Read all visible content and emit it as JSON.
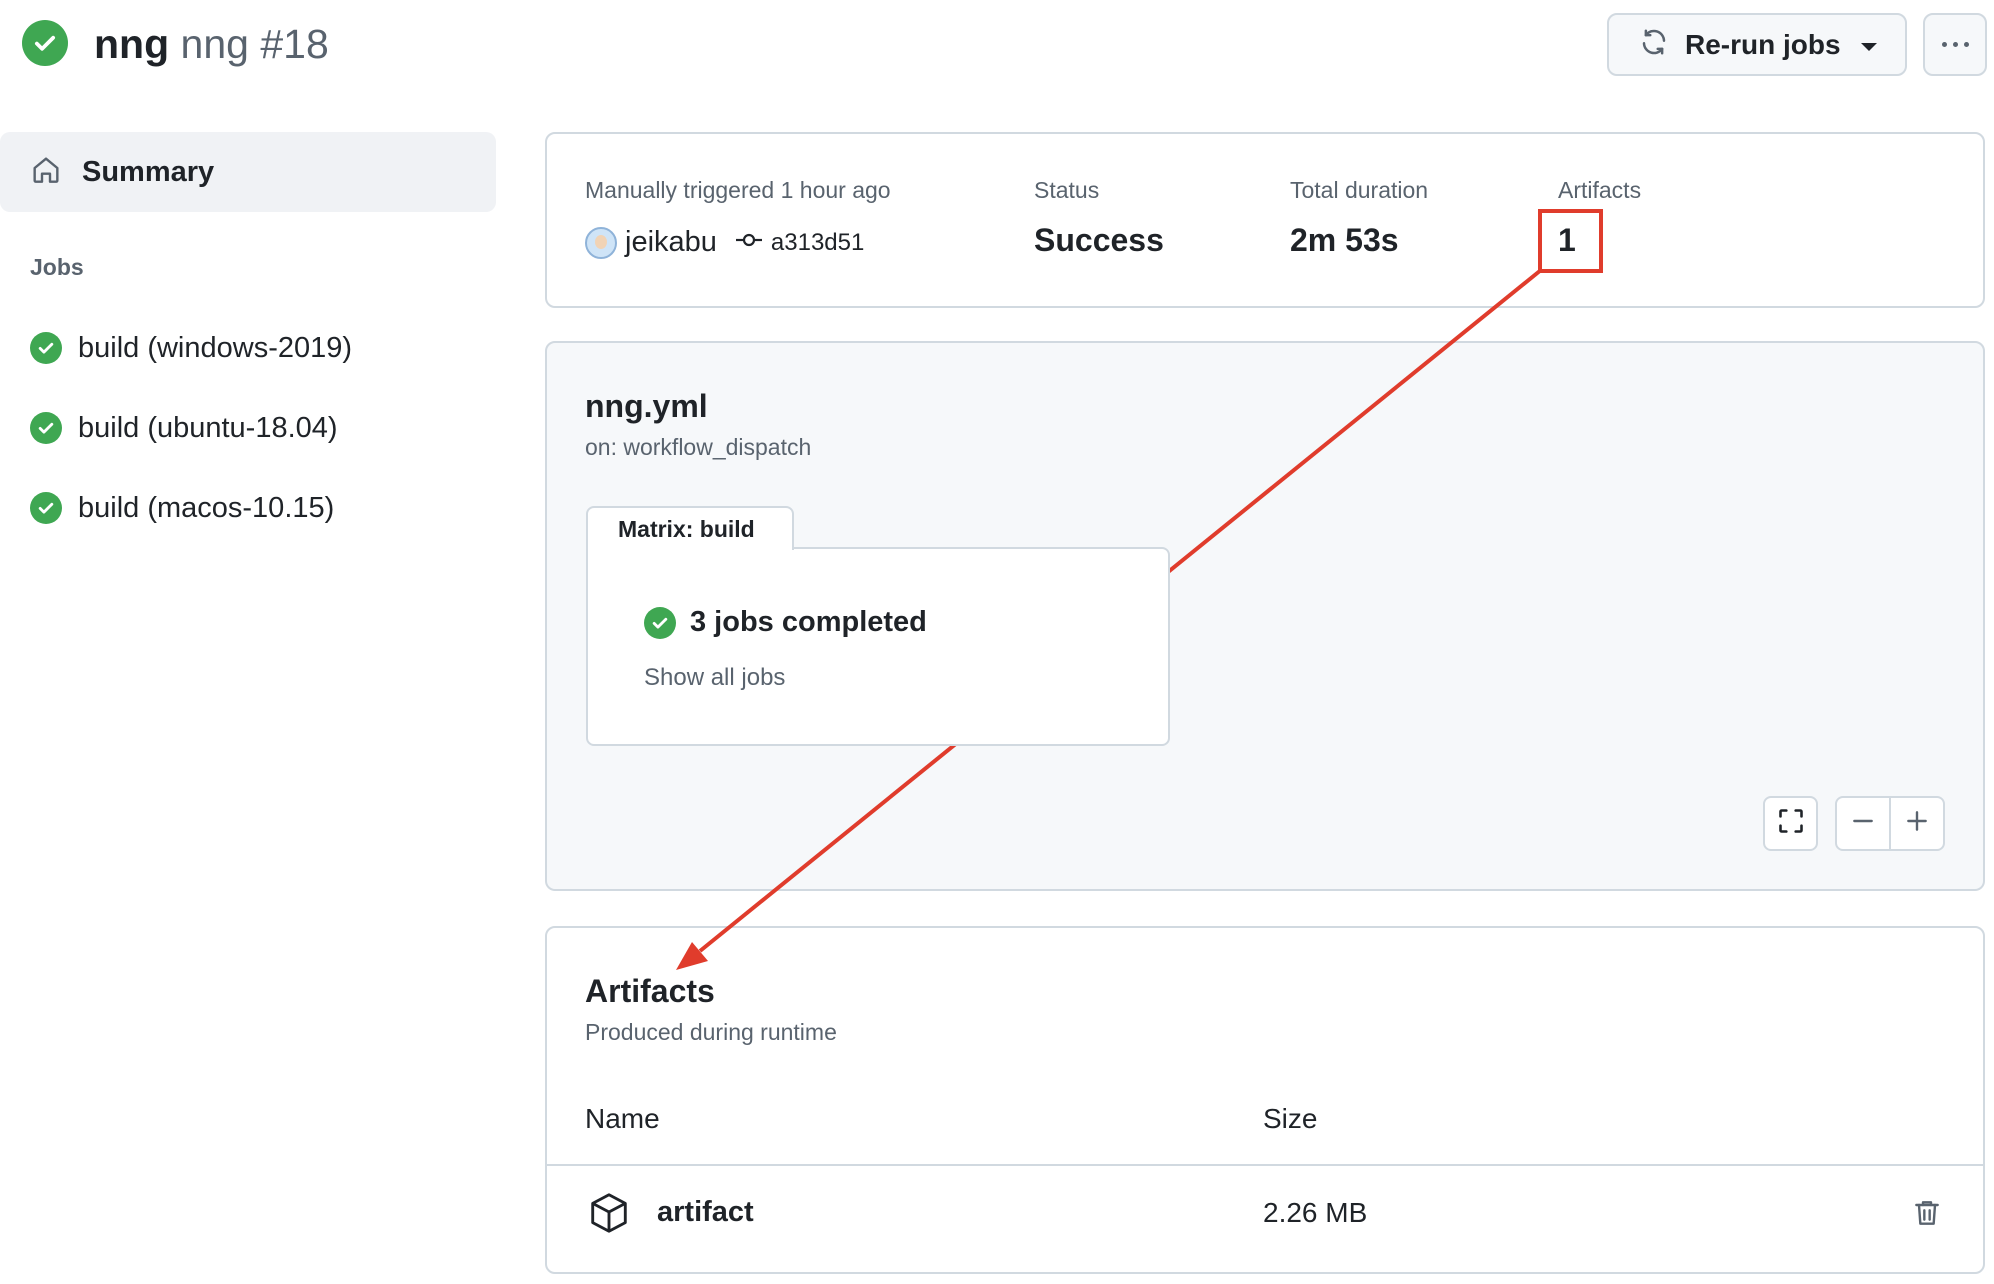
{
  "header": {
    "workflow_name": "nng",
    "run_title": "nng #18",
    "rerun_label": "Re-run jobs"
  },
  "sidebar": {
    "summary_label": "Summary",
    "jobs_heading": "Jobs",
    "jobs": [
      {
        "label": "build (windows-2019)"
      },
      {
        "label": "build (ubuntu-18.04)"
      },
      {
        "label": "build (macos-10.15)"
      }
    ]
  },
  "summary": {
    "trigger_label": "Manually triggered 1 hour ago",
    "actor": "jeikabu",
    "commit": "a313d51",
    "status_label": "Status",
    "status_value": "Success",
    "duration_label": "Total duration",
    "duration_value": "2m 53s",
    "artifacts_label": "Artifacts",
    "artifacts_value": "1"
  },
  "graph": {
    "file": "nng.yml",
    "trigger": "on: workflow_dispatch",
    "matrix_label": "Matrix: build",
    "jobs_completed": "3 jobs completed",
    "show_all": "Show all jobs"
  },
  "artifacts": {
    "title": "Artifacts",
    "subtitle": "Produced during runtime",
    "col_name": "Name",
    "col_size": "Size",
    "rows": [
      {
        "name": "artifact",
        "size": "2.26 MB"
      }
    ]
  },
  "colors": {
    "success": "#3fa752",
    "annotation": "#e03c2c",
    "border": "#d1d9e0"
  },
  "icons": {
    "status": "check-circle-icon",
    "rerun": "sync-icon",
    "more": "kebab-horizontal-icon",
    "summary": "home-icon",
    "commit": "git-commit-icon",
    "fullscreen": "screen-full-icon",
    "zoom_out": "dash-icon",
    "zoom_in": "plus-icon",
    "artifact": "package-icon",
    "delete": "trash-icon"
  }
}
